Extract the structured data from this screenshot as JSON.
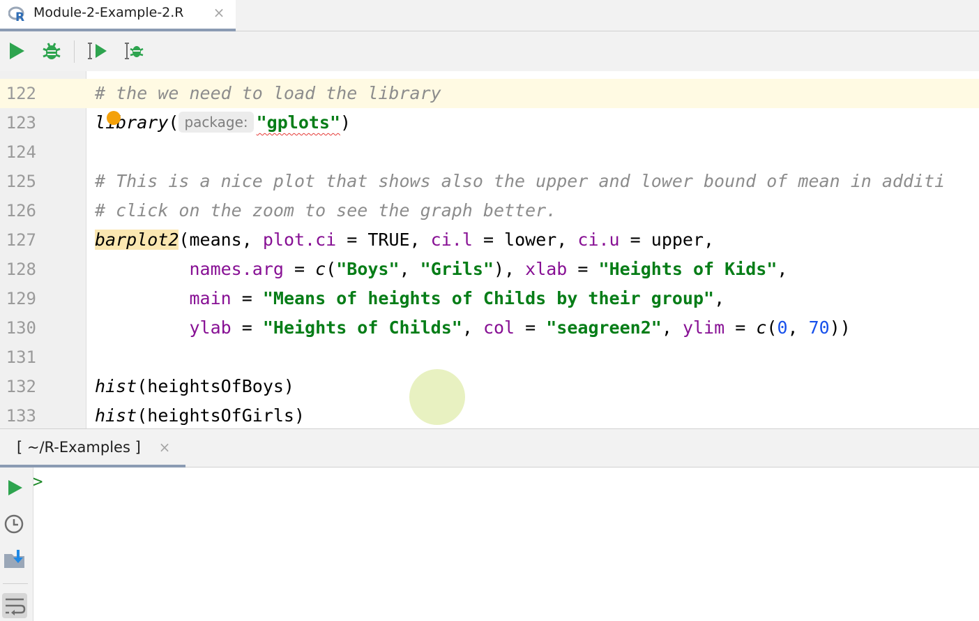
{
  "editor_tab": {
    "title": "Module-2-Example-2.R",
    "close": "×"
  },
  "toolbar": {
    "run_icon": "run-icon",
    "debug_icon": "debug-icon",
    "run_selection_icon": "run-selection-icon",
    "debug_selection_icon": "debug-selection-icon"
  },
  "editor": {
    "line_numbers": [
      "122",
      "123",
      "124",
      "125",
      "126",
      "127",
      "128",
      "129",
      "130",
      "131",
      "132",
      "133"
    ],
    "lines": {
      "l122": "# the we need to load the library",
      "l123": {
        "fn_a": "l",
        "fn_b": "ibrary",
        "open": "(",
        "hint": "package:",
        "arg": "\"gplots\"",
        "close": ")"
      },
      "l125": "# This is a nice plot that shows also the upper and lower bound of mean in additi",
      "l126": "# click on the zoom to see the graph better.",
      "l127": {
        "fn": "barplot2",
        "t1": "(means, ",
        "a1": "plot.ci",
        "t2": " = TRUE, ",
        "a2": "ci.l",
        "t3": " = lower, ",
        "a3": "ci.u",
        "t4": " = upper,"
      },
      "l128": {
        "indent": "         ",
        "a1": "names.arg",
        "t1": " = ",
        "f1": "c",
        "t2": "(",
        "s1": "\"Boys\"",
        "t3": ", ",
        "s2": "\"Grils\"",
        "t4": "), ",
        "a2": "xlab",
        "t5": " = ",
        "s3": "\"Heights of Kids\"",
        "t6": ","
      },
      "l129": {
        "indent": "         ",
        "a1": "main",
        "t1": " = ",
        "s1": "\"Means of heights of Childs by their group\"",
        "t2": ","
      },
      "l130": {
        "indent": "         ",
        "a1": "ylab",
        "t1": " = ",
        "s1": "\"Heights of Childs\"",
        "t2": ", ",
        "a2": "col",
        "t3": " = ",
        "s2": "\"seagreen2\"",
        "t4": ", ",
        "a3": "ylim",
        "t5": " = ",
        "f1": "c",
        "t6": "(",
        "n1": "0",
        "t7": ", ",
        "n2": "70",
        "t8": "))"
      },
      "l132": {
        "fn": "hist",
        "rest": "(heightsOfBoys)"
      },
      "l133": {
        "fn": "hist",
        "rest": "(heightsOfGirls)"
      }
    }
  },
  "console": {
    "tab_title": "[ ~/R-Examples ]",
    "close": "×",
    "prompt": ">",
    "side_icons": [
      "run-icon",
      "history-icon",
      "import-icon",
      "soft-wrap-icon"
    ]
  },
  "colors": {
    "run_green": "#2ea44f",
    "comment": "#8c8c8c",
    "string": "#067d17",
    "argument": "#871094",
    "number": "#1750eb",
    "caret_row": "#fffae3"
  }
}
